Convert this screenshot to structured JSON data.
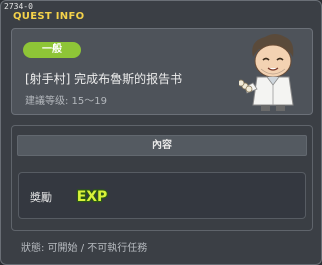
{
  "window": {
    "quest_id": "2734-0",
    "title": "QUEST INFO"
  },
  "quest": {
    "category_badge": "一般",
    "name": "[射手村] 完成布魯斯的报告书",
    "recommended_level": "建議等级: 15～19",
    "npc_portrait": "npc-scientist-portrait"
  },
  "content": {
    "header": "內容",
    "reward_label": "獎勵",
    "reward_icon_text": "EXP"
  },
  "footer": {
    "status": "狀態: 可開始 / 不可執行任務"
  },
  "colors": {
    "title": "#f4d24a",
    "badge": "#8ec537",
    "exp_fill": "#d9f23a",
    "exp_outline": "#2b5a12"
  }
}
